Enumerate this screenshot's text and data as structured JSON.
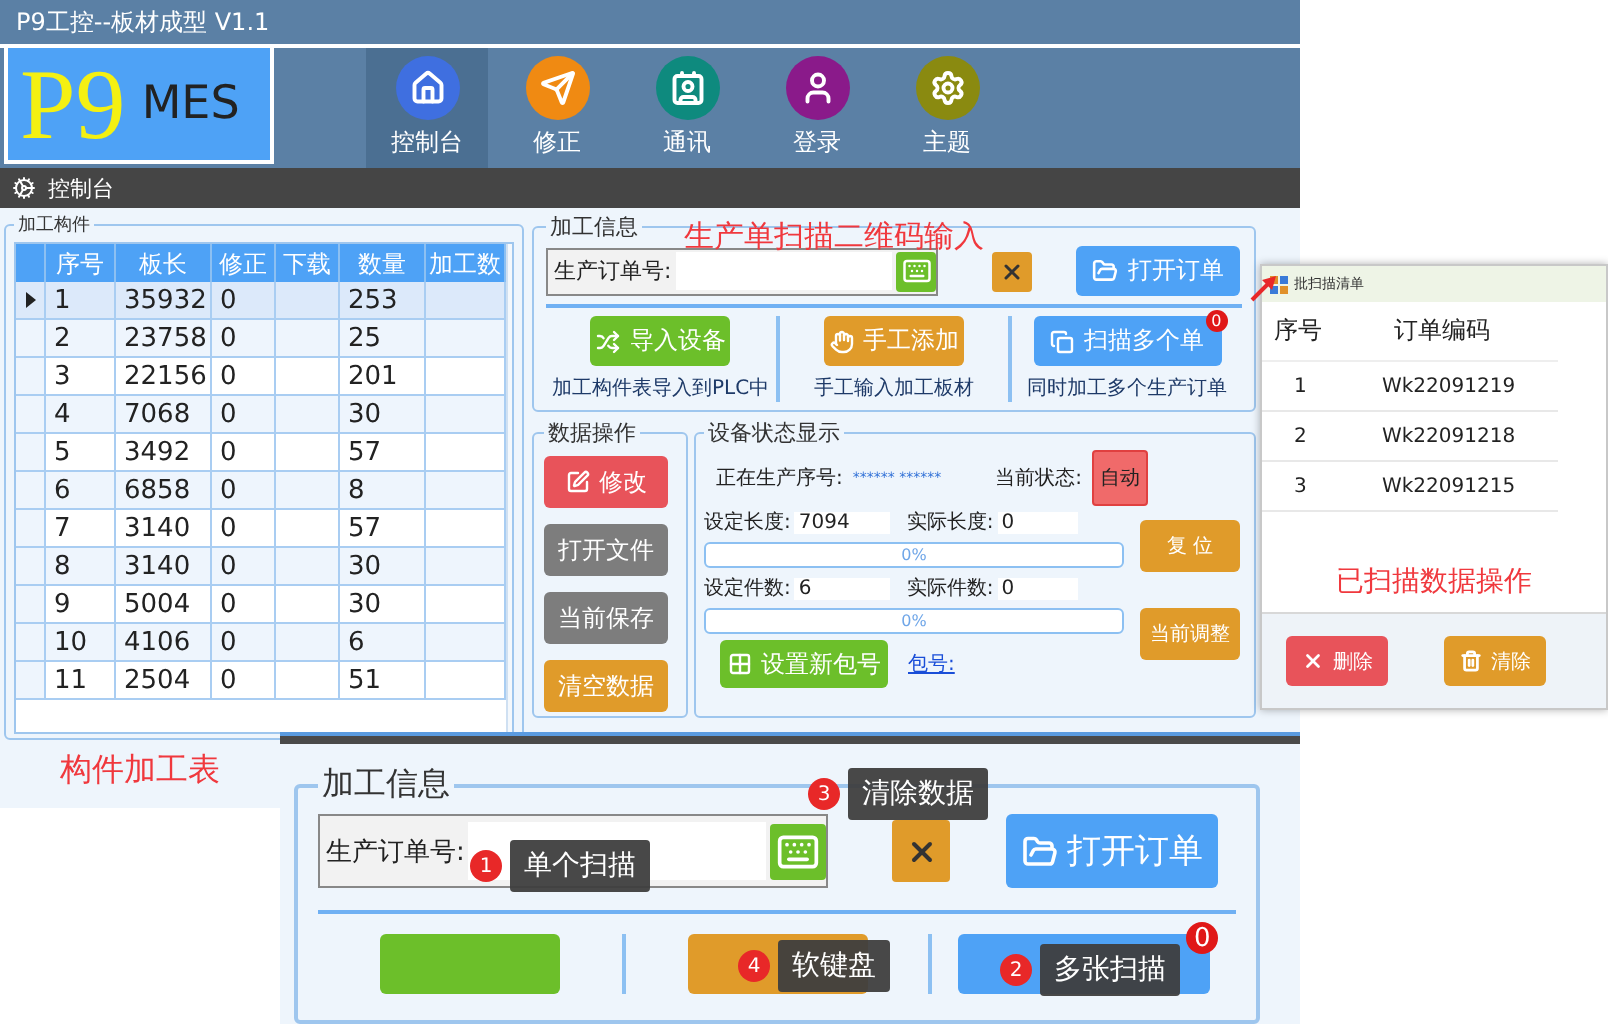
{
  "window": {
    "title": "P9工控--板材成型  V1.1"
  },
  "logo": {
    "mark": "P9",
    "text": "MES"
  },
  "nav": [
    {
      "label": "控制台",
      "kind": "home",
      "color": "#3f6fe0",
      "selected": true
    },
    {
      "label": "修正",
      "kind": "send",
      "color": "#f08a12",
      "selected": false
    },
    {
      "label": "通讯",
      "kind": "contact",
      "color": "#0e8a7e",
      "selected": false
    },
    {
      "label": "登录",
      "kind": "user",
      "color": "#8a1a8a",
      "selected": false
    },
    {
      "label": "主题",
      "kind": "settings",
      "color": "#8a8a10",
      "selected": false
    }
  ],
  "breadcrumb": "控制台",
  "parts_table": {
    "legend": "加工构件",
    "columns": [
      "序号",
      "板长",
      "修正",
      "下载",
      "数量",
      "加工数"
    ],
    "rows": [
      {
        "cells": [
          "1",
          "35932",
          "0",
          "",
          "253",
          ""
        ],
        "selected": true
      },
      {
        "cells": [
          "2",
          "23758",
          "0",
          "",
          "25",
          ""
        ],
        "selected": false
      },
      {
        "cells": [
          "3",
          "22156",
          "0",
          "",
          "201",
          ""
        ],
        "selected": false
      },
      {
        "cells": [
          "4",
          "7068",
          "0",
          "",
          "30",
          ""
        ],
        "selected": false
      },
      {
        "cells": [
          "5",
          "3492",
          "0",
          "",
          "57",
          ""
        ],
        "selected": false
      },
      {
        "cells": [
          "6",
          "6858",
          "0",
          "",
          "8",
          ""
        ],
        "selected": false
      },
      {
        "cells": [
          "7",
          "3140",
          "0",
          "",
          "57",
          ""
        ],
        "selected": false
      },
      {
        "cells": [
          "8",
          "3140",
          "0",
          "",
          "30",
          ""
        ],
        "selected": false
      },
      {
        "cells": [
          "9",
          "5004",
          "0",
          "",
          "30",
          ""
        ],
        "selected": false
      },
      {
        "cells": [
          "10",
          "4106",
          "0",
          "",
          "6",
          ""
        ],
        "selected": false
      },
      {
        "cells": [
          "11",
          "2504",
          "0",
          "",
          "51",
          ""
        ],
        "selected": false
      }
    ]
  },
  "parts_caption": "构件加工表",
  "process_info": {
    "legend": "加工信息",
    "annotation": "生产单扫描二维码输入",
    "order_label": "生产订单号:",
    "open_button": "打开订单",
    "actions": [
      {
        "label": "导入设备",
        "caption": "加工构件表导入到PLC中",
        "kind": "import"
      },
      {
        "label": "手工添加",
        "caption": "手工输入加工板材",
        "kind": "manual"
      },
      {
        "label": "扫描多个单",
        "caption": "同时加工多个生产订单",
        "kind": "multi",
        "badge": "0"
      }
    ]
  },
  "data_ops": {
    "legend": "数据操作",
    "buttons": [
      {
        "label": "修改",
        "kind": "edit"
      },
      {
        "label": "打开文件",
        "kind": "file"
      },
      {
        "label": "当前保存",
        "kind": "save"
      },
      {
        "label": "清空数据",
        "kind": "clear"
      }
    ]
  },
  "status": {
    "legend": "设备状态显示",
    "current_label": "正在生产序号:",
    "current_value": "****** ******",
    "state_label": "当前状态:",
    "state": "自动",
    "meters": [
      {
        "set_label": "设定长度:",
        "set_value": "7094",
        "actual_label": "实际长度:",
        "actual_value": "0",
        "level": 0,
        "percent": "0%"
      },
      {
        "set_label": "设定件数:",
        "set_value": "6",
        "actual_label": "实际件数:",
        "actual_value": "0",
        "level": 0,
        "percent": "0%"
      }
    ],
    "side_buttons": [
      "复 位",
      "当前调整"
    ],
    "package_button": "设置新包号",
    "package_link": "包号:"
  },
  "popup": {
    "title": "批扫描清单",
    "columns": [
      "序号",
      "订单编码"
    ],
    "rows": [
      {
        "index": "1",
        "code": "Wk22091219"
      },
      {
        "index": "2",
        "code": "Wk22091218"
      },
      {
        "index": "3",
        "code": "Wk22091215"
      }
    ],
    "annotation": "已扫描数据操作",
    "buttons": [
      {
        "label": "删除",
        "kind": "delete"
      },
      {
        "label": "清除",
        "kind": "clear"
      }
    ]
  },
  "inset": {
    "legend": "加工信息",
    "order_label": "生产订单号:",
    "open_button": "打开订单",
    "badge": "0",
    "callouts": [
      {
        "number": "1",
        "text": "单个扫描"
      },
      {
        "number": "3",
        "text": "清除数据"
      },
      {
        "number": "4",
        "text": "软键盘"
      },
      {
        "number": "2",
        "text": "多张扫描"
      }
    ]
  }
}
